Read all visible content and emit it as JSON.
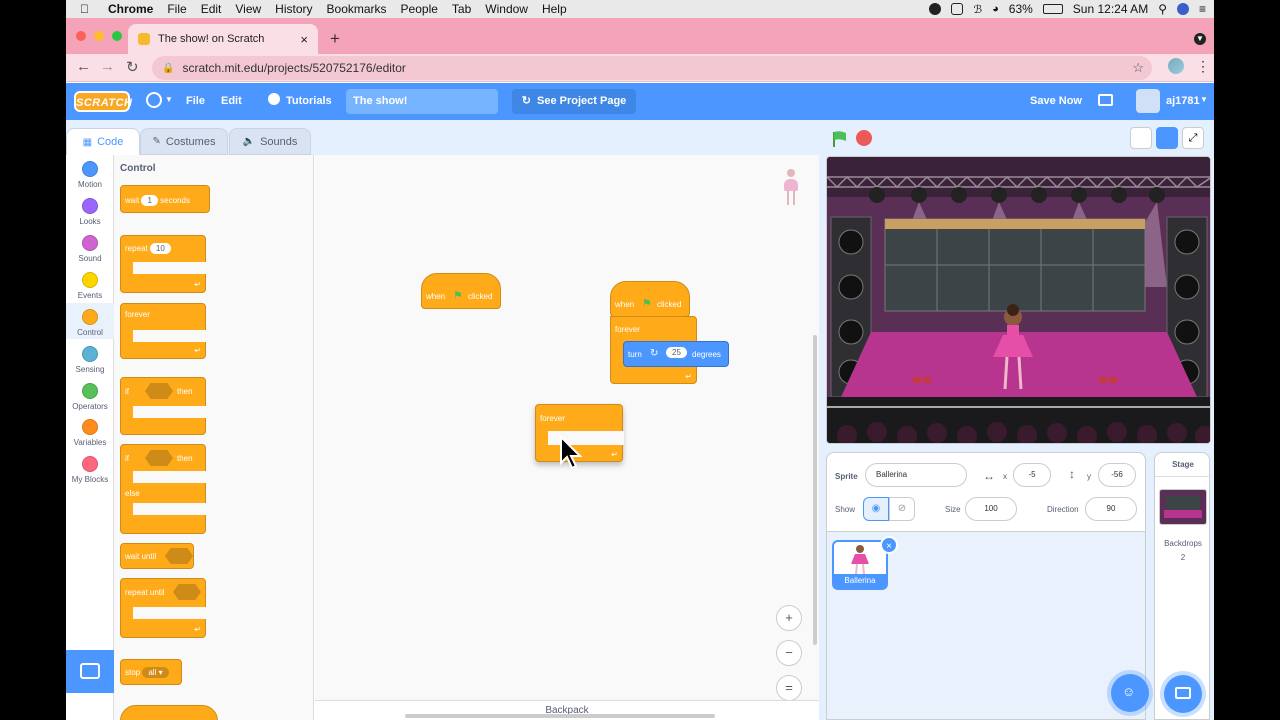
{
  "macbar": {
    "app": "Chrome",
    "menus": [
      "File",
      "Edit",
      "View",
      "History",
      "Bookmarks",
      "People",
      "Tab",
      "Window",
      "Help"
    ],
    "battery": "63%",
    "clock": "Sun 12:24 AM"
  },
  "browser": {
    "tab_title": "The show! on Scratch",
    "url": "scratch.mit.edu/projects/520752176/editor"
  },
  "scratch_header": {
    "logo": "SCRATCH",
    "file": "File",
    "edit": "Edit",
    "tutorials": "Tutorials",
    "project_title": "The show!",
    "see_project": "See Project Page",
    "save_now": "Save Now",
    "username": "aj1781"
  },
  "editor_tabs": {
    "code": "Code",
    "costumes": "Costumes",
    "sounds": "Sounds"
  },
  "categories": [
    {
      "label": "Motion",
      "color": "#4c97ff"
    },
    {
      "label": "Looks",
      "color": "#9966ff"
    },
    {
      "label": "Sound",
      "color": "#cf63cf"
    },
    {
      "label": "Events",
      "color": "#ffd500"
    },
    {
      "label": "Control",
      "color": "#ffab19"
    },
    {
      "label": "Sensing",
      "color": "#5cb1d6"
    },
    {
      "label": "Operators",
      "color": "#59c059"
    },
    {
      "label": "Variables",
      "color": "#ff8c1a"
    },
    {
      "label": "My Blocks",
      "color": "#ff6680"
    }
  ],
  "palette": {
    "title": "Control",
    "wait": "wait",
    "wait_val": "1",
    "seconds": "seconds",
    "repeat": "repeat",
    "repeat_val": "10",
    "forever": "forever",
    "if1": "if",
    "then1": "then",
    "if2": "if",
    "then2": "then",
    "else": "else",
    "wait_until": "wait until",
    "repeat_until": "repeat until",
    "stop": "stop",
    "stop_val": "all"
  },
  "workspace": {
    "hat1_when": "when",
    "hat1_clicked": "clicked",
    "hat2_when": "when",
    "hat2_clicked": "clicked",
    "forever1": "forever",
    "turn": "turn",
    "turn_val": "25",
    "degrees": "degrees",
    "forever2": "forever",
    "backpack": "Backpack"
  },
  "sprite_info": {
    "sprite_label": "Sprite",
    "sprite_name": "Ballerina",
    "x_label": "x",
    "x": "-5",
    "y_label": "y",
    "y": "-56",
    "show_label": "Show",
    "size_label": "Size",
    "size": "100",
    "direction_label": "Direction",
    "direction": "90"
  },
  "sprites": [
    {
      "name": "Ballerina"
    }
  ],
  "stage_panel": {
    "title": "Stage",
    "backdrops_label": "Backdrops",
    "backdrops_count": "2"
  }
}
